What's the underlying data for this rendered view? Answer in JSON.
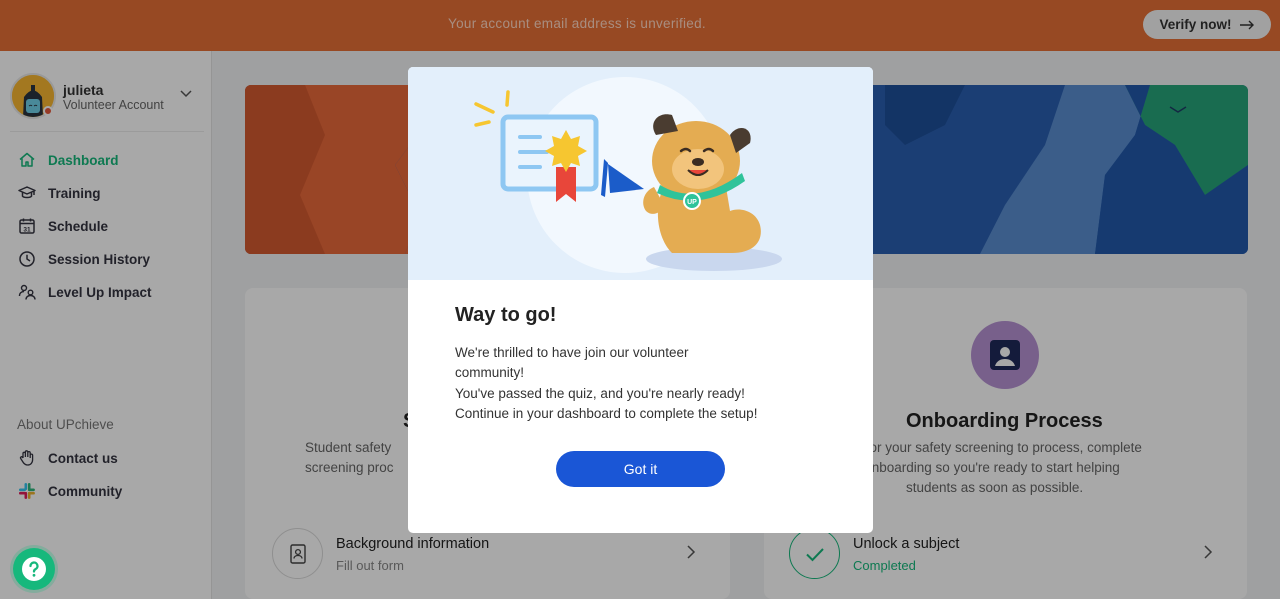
{
  "banner": {
    "message": "Your account email address is unverified.",
    "verify_label": "Verify now!",
    "color": "#e56f36"
  },
  "profile": {
    "name": "julieta",
    "role": "Volunteer Account",
    "status_color": "#e5593b"
  },
  "sidebar": {
    "items": [
      {
        "label": "Dashboard",
        "icon": "home-icon",
        "active": true
      },
      {
        "label": "Training",
        "icon": "graduation-cap-icon"
      },
      {
        "label": "Schedule",
        "icon": "calendar-icon"
      },
      {
        "label": "Session History",
        "icon": "clock-icon"
      },
      {
        "label": "Level Up Impact",
        "icon": "people-icon"
      }
    ],
    "about_label": "About UPchieve",
    "about_items": [
      {
        "label": "Contact us",
        "icon": "hand-wave-icon"
      },
      {
        "label": "Community",
        "icon": "slack-icon"
      }
    ]
  },
  "cards": {
    "left": {
      "title_fragment": "S",
      "desc_line1": "Student safety",
      "desc_line2": "screening proc",
      "task": {
        "title": "Background information",
        "subtitle": "Fill out form"
      }
    },
    "right": {
      "title": "Onboarding Process",
      "desc_line1": "ing for your safety screening to process, complete",
      "desc_line2": "ick onboarding so you're ready to start helping",
      "desc_line3": "students as soon as possible.",
      "task": {
        "title": "Unlock a subject",
        "subtitle": "Completed"
      }
    }
  },
  "modal": {
    "title": "Way to go!",
    "line1": "We're thrilled to have join our volunteer",
    "line2": "community!",
    "line3": "You've passed the quiz, and you're nearly ready!",
    "line4": "Continue in your dashboard to complete the setup!",
    "button_label": "Got it",
    "accent": "#1a56d6"
  },
  "colors": {
    "accent_green": "#16b87c",
    "brand_orange": "#e56f36",
    "primary_blue": "#1a56d6"
  }
}
